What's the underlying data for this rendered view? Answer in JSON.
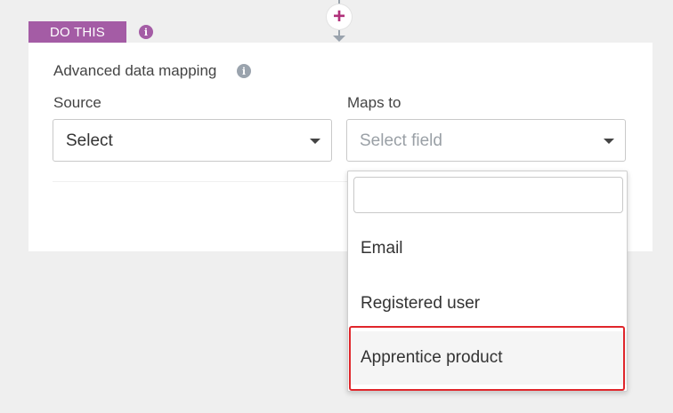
{
  "connector": {
    "add_icon": "plus-icon",
    "add_glyph": "+"
  },
  "step": {
    "tag_label": "DO THIS",
    "info_icon": "info-icon",
    "info_glyph": "i"
  },
  "card": {
    "title": "Advanced data mapping",
    "source": {
      "label": "Source",
      "value": "Select"
    },
    "maps_to": {
      "label": "Maps to",
      "placeholder": "Select field"
    }
  },
  "dropdown": {
    "search_value": "",
    "options": [
      {
        "label": "Email"
      },
      {
        "label": "Registered user"
      },
      {
        "label": "Apprentice product",
        "highlighted": true
      }
    ]
  },
  "colors": {
    "accent_purple": "#a45ca5",
    "add_magenta": "#b0307a",
    "highlight_red": "#e0262b"
  }
}
